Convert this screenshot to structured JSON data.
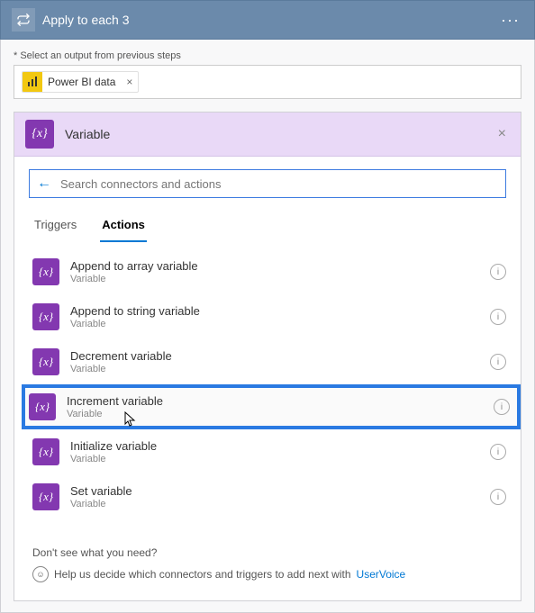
{
  "header": {
    "title": "Apply to each 3"
  },
  "output_field": {
    "label": "* Select an output from previous steps",
    "chip_text": "Power BI data"
  },
  "variable_panel": {
    "title": "Variable",
    "search_placeholder": "Search connectors and actions",
    "search_value": ""
  },
  "tabs": {
    "triggers": "Triggers",
    "actions": "Actions"
  },
  "actions": [
    {
      "title": "Append to array variable",
      "sub": "Variable"
    },
    {
      "title": "Append to string variable",
      "sub": "Variable"
    },
    {
      "title": "Decrement variable",
      "sub": "Variable"
    },
    {
      "title": "Increment variable",
      "sub": "Variable"
    },
    {
      "title": "Initialize variable",
      "sub": "Variable"
    },
    {
      "title": "Set variable",
      "sub": "Variable"
    }
  ],
  "footer": {
    "question": "Don't see what you need?",
    "help_text": "Help us decide which connectors and triggers to add next with",
    "link_text": "UserVoice"
  }
}
